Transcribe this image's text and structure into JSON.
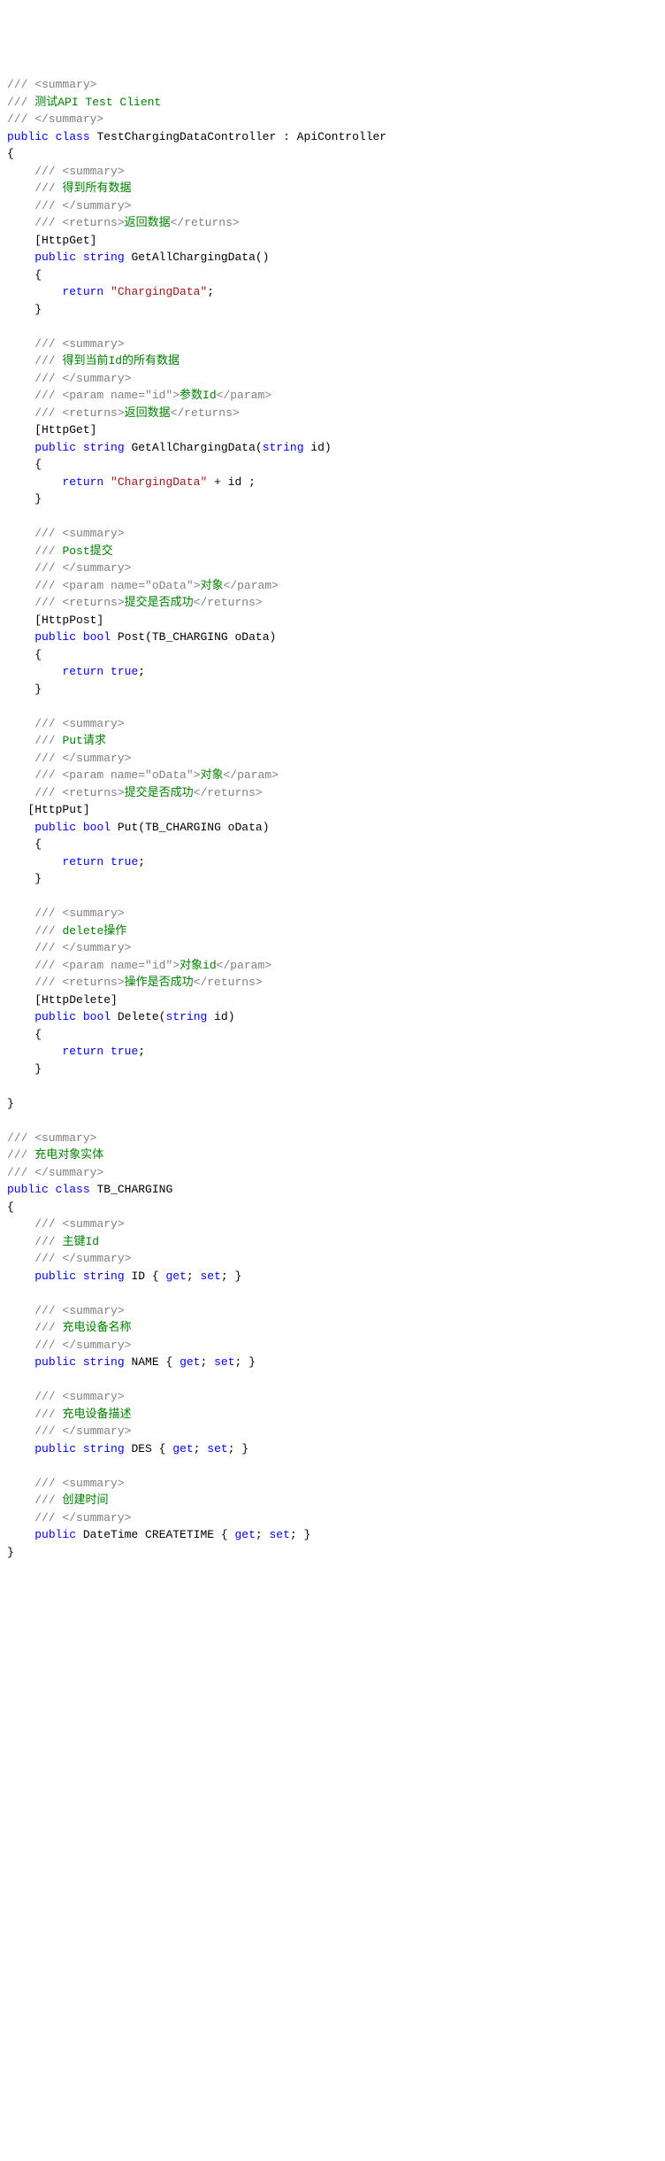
{
  "lines": [
    {
      "t": "/// <summary>",
      "c": "c-gray"
    },
    {
      "segs": [
        {
          "t": "/// ",
          "c": "c-gray"
        },
        {
          "t": "测试API Test Client",
          "c": "c-green"
        }
      ]
    },
    {
      "t": "/// </summary>",
      "c": "c-gray"
    },
    {
      "segs": [
        {
          "t": "public",
          "c": "c-blue"
        },
        {
          "t": " "
        },
        {
          "t": "class",
          "c": "c-blue"
        },
        {
          "t": " TestChargingDataController : ApiController"
        }
      ]
    },
    {
      "t": "{"
    },
    {
      "segs": [
        {
          "t": "    "
        },
        {
          "t": "/// <summary>",
          "c": "c-gray"
        }
      ]
    },
    {
      "segs": [
        {
          "t": "    "
        },
        {
          "t": "/// ",
          "c": "c-gray"
        },
        {
          "t": "得到所有数据",
          "c": "c-green"
        }
      ]
    },
    {
      "segs": [
        {
          "t": "    "
        },
        {
          "t": "/// </summary>",
          "c": "c-gray"
        }
      ]
    },
    {
      "segs": [
        {
          "t": "    "
        },
        {
          "t": "/// <returns>",
          "c": "c-gray"
        },
        {
          "t": "返回数据",
          "c": "c-green"
        },
        {
          "t": "</returns>",
          "c": "c-gray"
        }
      ]
    },
    {
      "t": "    [HttpGet]"
    },
    {
      "segs": [
        {
          "t": "    "
        },
        {
          "t": "public",
          "c": "c-blue"
        },
        {
          "t": " "
        },
        {
          "t": "string",
          "c": "c-blue"
        },
        {
          "t": " GetAllChargingData()"
        }
      ]
    },
    {
      "t": "    {"
    },
    {
      "segs": [
        {
          "t": "        "
        },
        {
          "t": "return",
          "c": "c-blue"
        },
        {
          "t": " "
        },
        {
          "t": "\"ChargingData\"",
          "c": "c-red"
        },
        {
          "t": ";"
        }
      ]
    },
    {
      "t": "    }"
    },
    {
      "t": ""
    },
    {
      "segs": [
        {
          "t": "    "
        },
        {
          "t": "/// <summary>",
          "c": "c-gray"
        }
      ]
    },
    {
      "segs": [
        {
          "t": "    "
        },
        {
          "t": "/// ",
          "c": "c-gray"
        },
        {
          "t": "得到当前Id的所有数据",
          "c": "c-green"
        }
      ]
    },
    {
      "segs": [
        {
          "t": "    "
        },
        {
          "t": "/// </summary>",
          "c": "c-gray"
        }
      ]
    },
    {
      "segs": [
        {
          "t": "    "
        },
        {
          "t": "/// <param name=\"id\">",
          "c": "c-gray"
        },
        {
          "t": "参数Id",
          "c": "c-green"
        },
        {
          "t": "</param>",
          "c": "c-gray"
        }
      ]
    },
    {
      "segs": [
        {
          "t": "    "
        },
        {
          "t": "/// <returns>",
          "c": "c-gray"
        },
        {
          "t": "返回数据",
          "c": "c-green"
        },
        {
          "t": "</returns>",
          "c": "c-gray"
        }
      ]
    },
    {
      "t": "    [HttpGet]"
    },
    {
      "segs": [
        {
          "t": "    "
        },
        {
          "t": "public",
          "c": "c-blue"
        },
        {
          "t": " "
        },
        {
          "t": "string",
          "c": "c-blue"
        },
        {
          "t": " GetAllChargingData("
        },
        {
          "t": "string",
          "c": "c-blue"
        },
        {
          "t": " id)"
        }
      ]
    },
    {
      "t": "    {"
    },
    {
      "segs": [
        {
          "t": "        "
        },
        {
          "t": "return",
          "c": "c-blue"
        },
        {
          "t": " "
        },
        {
          "t": "\"ChargingData\"",
          "c": "c-red"
        },
        {
          "t": " + id ;"
        }
      ]
    },
    {
      "t": "    }"
    },
    {
      "t": ""
    },
    {
      "segs": [
        {
          "t": "    "
        },
        {
          "t": "/// <summary>",
          "c": "c-gray"
        }
      ]
    },
    {
      "segs": [
        {
          "t": "    "
        },
        {
          "t": "/// ",
          "c": "c-gray"
        },
        {
          "t": "Post提交",
          "c": "c-green"
        }
      ]
    },
    {
      "segs": [
        {
          "t": "    "
        },
        {
          "t": "/// </summary>",
          "c": "c-gray"
        }
      ]
    },
    {
      "segs": [
        {
          "t": "    "
        },
        {
          "t": "/// <param name=\"oData\">",
          "c": "c-gray"
        },
        {
          "t": "对象",
          "c": "c-green"
        },
        {
          "t": "</param>",
          "c": "c-gray"
        }
      ]
    },
    {
      "segs": [
        {
          "t": "    "
        },
        {
          "t": "/// <returns>",
          "c": "c-gray"
        },
        {
          "t": "提交是否成功",
          "c": "c-green"
        },
        {
          "t": "</returns>",
          "c": "c-gray"
        }
      ]
    },
    {
      "t": "    [HttpPost]"
    },
    {
      "segs": [
        {
          "t": "    "
        },
        {
          "t": "public",
          "c": "c-blue"
        },
        {
          "t": " "
        },
        {
          "t": "bool",
          "c": "c-blue"
        },
        {
          "t": " Post(TB_CHARGING oData)"
        }
      ]
    },
    {
      "t": "    {"
    },
    {
      "segs": [
        {
          "t": "        "
        },
        {
          "t": "return",
          "c": "c-blue"
        },
        {
          "t": " "
        },
        {
          "t": "true",
          "c": "c-blue"
        },
        {
          "t": ";"
        }
      ]
    },
    {
      "t": "    }"
    },
    {
      "t": ""
    },
    {
      "segs": [
        {
          "t": "    "
        },
        {
          "t": "/// <summary>",
          "c": "c-gray"
        }
      ]
    },
    {
      "segs": [
        {
          "t": "    "
        },
        {
          "t": "/// ",
          "c": "c-gray"
        },
        {
          "t": "Put请求",
          "c": "c-green"
        }
      ]
    },
    {
      "segs": [
        {
          "t": "    "
        },
        {
          "t": "/// </summary>",
          "c": "c-gray"
        }
      ]
    },
    {
      "segs": [
        {
          "t": "    "
        },
        {
          "t": "/// <param name=\"oData\">",
          "c": "c-gray"
        },
        {
          "t": "对象",
          "c": "c-green"
        },
        {
          "t": "</param>",
          "c": "c-gray"
        }
      ]
    },
    {
      "segs": [
        {
          "t": "    "
        },
        {
          "t": "/// <returns>",
          "c": "c-gray"
        },
        {
          "t": "提交是否成功",
          "c": "c-green"
        },
        {
          "t": "</returns>",
          "c": "c-gray"
        }
      ]
    },
    {
      "t": "   [HttpPut]"
    },
    {
      "segs": [
        {
          "t": "    "
        },
        {
          "t": "public",
          "c": "c-blue"
        },
        {
          "t": " "
        },
        {
          "t": "bool",
          "c": "c-blue"
        },
        {
          "t": " Put(TB_CHARGING oData)"
        }
      ]
    },
    {
      "t": "    {"
    },
    {
      "segs": [
        {
          "t": "        "
        },
        {
          "t": "return",
          "c": "c-blue"
        },
        {
          "t": " "
        },
        {
          "t": "true",
          "c": "c-blue"
        },
        {
          "t": ";"
        }
      ]
    },
    {
      "t": "    }"
    },
    {
      "t": ""
    },
    {
      "segs": [
        {
          "t": "    "
        },
        {
          "t": "/// <summary>",
          "c": "c-gray"
        }
      ]
    },
    {
      "segs": [
        {
          "t": "    "
        },
        {
          "t": "/// ",
          "c": "c-gray"
        },
        {
          "t": "delete操作",
          "c": "c-green"
        }
      ]
    },
    {
      "segs": [
        {
          "t": "    "
        },
        {
          "t": "/// </summary>",
          "c": "c-gray"
        }
      ]
    },
    {
      "segs": [
        {
          "t": "    "
        },
        {
          "t": "/// <param name=\"id\">",
          "c": "c-gray"
        },
        {
          "t": "对象id",
          "c": "c-green"
        },
        {
          "t": "</param>",
          "c": "c-gray"
        }
      ]
    },
    {
      "segs": [
        {
          "t": "    "
        },
        {
          "t": "/// <returns>",
          "c": "c-gray"
        },
        {
          "t": "操作是否成功",
          "c": "c-green"
        },
        {
          "t": "</returns>",
          "c": "c-gray"
        }
      ]
    },
    {
      "t": "    [HttpDelete]"
    },
    {
      "segs": [
        {
          "t": "    "
        },
        {
          "t": "public",
          "c": "c-blue"
        },
        {
          "t": " "
        },
        {
          "t": "bool",
          "c": "c-blue"
        },
        {
          "t": " Delete("
        },
        {
          "t": "string",
          "c": "c-blue"
        },
        {
          "t": " id)"
        }
      ]
    },
    {
      "t": "    {"
    },
    {
      "segs": [
        {
          "t": "        "
        },
        {
          "t": "return",
          "c": "c-blue"
        },
        {
          "t": " "
        },
        {
          "t": "true",
          "c": "c-blue"
        },
        {
          "t": ";"
        }
      ]
    },
    {
      "t": "    }"
    },
    {
      "t": ""
    },
    {
      "t": "}"
    },
    {
      "t": ""
    },
    {
      "t": "/// <summary>",
      "c": "c-gray"
    },
    {
      "segs": [
        {
          "t": "/// ",
          "c": "c-gray"
        },
        {
          "t": "充电对象实体",
          "c": "c-green"
        }
      ]
    },
    {
      "t": "/// </summary>",
      "c": "c-gray"
    },
    {
      "segs": [
        {
          "t": "public",
          "c": "c-blue"
        },
        {
          "t": " "
        },
        {
          "t": "class",
          "c": "c-blue"
        },
        {
          "t": " TB_CHARGING"
        }
      ]
    },
    {
      "t": "{"
    },
    {
      "segs": [
        {
          "t": "    "
        },
        {
          "t": "/// <summary>",
          "c": "c-gray"
        }
      ]
    },
    {
      "segs": [
        {
          "t": "    "
        },
        {
          "t": "/// ",
          "c": "c-gray"
        },
        {
          "t": "主键Id",
          "c": "c-green"
        }
      ]
    },
    {
      "segs": [
        {
          "t": "    "
        },
        {
          "t": "/// </summary>",
          "c": "c-gray"
        }
      ]
    },
    {
      "segs": [
        {
          "t": "    "
        },
        {
          "t": "public",
          "c": "c-blue"
        },
        {
          "t": " "
        },
        {
          "t": "string",
          "c": "c-blue"
        },
        {
          "t": " ID { "
        },
        {
          "t": "get",
          "c": "c-blue"
        },
        {
          "t": "; "
        },
        {
          "t": "set",
          "c": "c-blue"
        },
        {
          "t": "; }"
        }
      ]
    },
    {
      "t": ""
    },
    {
      "segs": [
        {
          "t": "    "
        },
        {
          "t": "/// <summary>",
          "c": "c-gray"
        }
      ]
    },
    {
      "segs": [
        {
          "t": "    "
        },
        {
          "t": "/// ",
          "c": "c-gray"
        },
        {
          "t": "充电设备名称",
          "c": "c-green"
        }
      ]
    },
    {
      "segs": [
        {
          "t": "    "
        },
        {
          "t": "/// </summary>",
          "c": "c-gray"
        }
      ]
    },
    {
      "segs": [
        {
          "t": "    "
        },
        {
          "t": "public",
          "c": "c-blue"
        },
        {
          "t": " "
        },
        {
          "t": "string",
          "c": "c-blue"
        },
        {
          "t": " NAME { "
        },
        {
          "t": "get",
          "c": "c-blue"
        },
        {
          "t": "; "
        },
        {
          "t": "set",
          "c": "c-blue"
        },
        {
          "t": "; }"
        }
      ]
    },
    {
      "t": ""
    },
    {
      "segs": [
        {
          "t": "    "
        },
        {
          "t": "/// <summary>",
          "c": "c-gray"
        }
      ]
    },
    {
      "segs": [
        {
          "t": "    "
        },
        {
          "t": "/// ",
          "c": "c-gray"
        },
        {
          "t": "充电设备描述",
          "c": "c-green"
        }
      ]
    },
    {
      "segs": [
        {
          "t": "    "
        },
        {
          "t": "/// </summary>",
          "c": "c-gray"
        }
      ]
    },
    {
      "segs": [
        {
          "t": "    "
        },
        {
          "t": "public",
          "c": "c-blue"
        },
        {
          "t": " "
        },
        {
          "t": "string",
          "c": "c-blue"
        },
        {
          "t": " DES { "
        },
        {
          "t": "get",
          "c": "c-blue"
        },
        {
          "t": "; "
        },
        {
          "t": "set",
          "c": "c-blue"
        },
        {
          "t": "; }"
        }
      ]
    },
    {
      "t": ""
    },
    {
      "segs": [
        {
          "t": "    "
        },
        {
          "t": "/// <summary>",
          "c": "c-gray"
        }
      ]
    },
    {
      "segs": [
        {
          "t": "    "
        },
        {
          "t": "/// ",
          "c": "c-gray"
        },
        {
          "t": "创建时间",
          "c": "c-green"
        }
      ]
    },
    {
      "segs": [
        {
          "t": "    "
        },
        {
          "t": "/// </summary>",
          "c": "c-gray"
        }
      ]
    },
    {
      "segs": [
        {
          "t": "    "
        },
        {
          "t": "public",
          "c": "c-blue"
        },
        {
          "t": " DateTime CREATETIME { "
        },
        {
          "t": "get",
          "c": "c-blue"
        },
        {
          "t": "; "
        },
        {
          "t": "set",
          "c": "c-blue"
        },
        {
          "t": "; }"
        }
      ]
    },
    {
      "t": "}"
    }
  ]
}
